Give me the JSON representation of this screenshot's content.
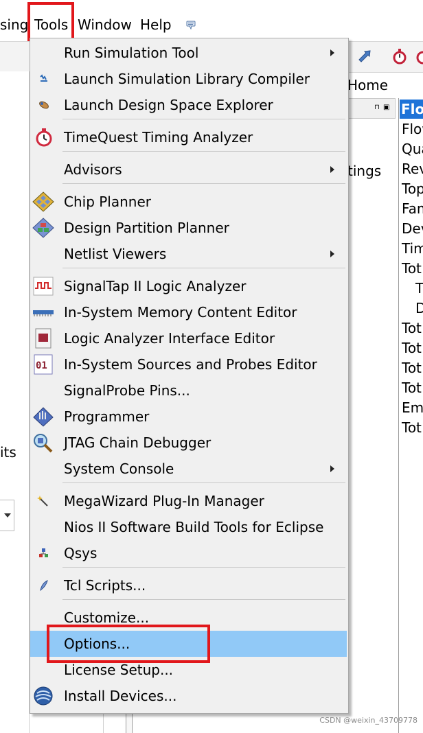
{
  "menubar": {
    "items": [
      "sing",
      "Tools",
      "Window",
      "Help"
    ]
  },
  "background": {
    "home_label": "Home",
    "partial_text_1": "tings",
    "partial_text_2": "its",
    "right_panel": {
      "title": "Flov",
      "rows": [
        "Flow",
        "Qua",
        "Rev",
        "Top",
        "Fam",
        "Dev",
        "Tim",
        "Tot",
        "T",
        "D",
        "Tot",
        "Tot",
        "Tot",
        "Tot",
        "Em",
        "Tot"
      ]
    }
  },
  "tools_menu": {
    "items": [
      {
        "label": "Run Simulation Tool",
        "icon": "none",
        "submenu": true
      },
      {
        "label": "Launch Simulation Library Compiler",
        "icon": "sim-library-icon",
        "submenu": false
      },
      {
        "label": "Launch Design Space Explorer",
        "icon": "design-space-explorer-icon",
        "submenu": false
      },
      {
        "label": "TimeQuest Timing Analyzer",
        "icon": "stopwatch-icon",
        "submenu": false
      },
      {
        "label": "Advisors",
        "icon": "none",
        "submenu": true
      },
      {
        "label": "Chip Planner",
        "icon": "chip-planner-icon",
        "submenu": false
      },
      {
        "label": "Design Partition Planner",
        "icon": "design-partition-icon",
        "submenu": false
      },
      {
        "label": "Netlist Viewers",
        "icon": "none",
        "submenu": true
      },
      {
        "label": "SignalTap II Logic Analyzer",
        "icon": "signaltap-icon",
        "submenu": false
      },
      {
        "label": "In-System Memory Content Editor",
        "icon": "memory-editor-icon",
        "submenu": false
      },
      {
        "label": "Logic Analyzer Interface Editor",
        "icon": "logic-analyzer-icon",
        "submenu": false
      },
      {
        "label": "In-System Sources and Probes Editor",
        "icon": "sources-probes-icon",
        "submenu": false
      },
      {
        "label": "SignalProbe Pins...",
        "icon": "none",
        "submenu": false
      },
      {
        "label": "Programmer",
        "icon": "programmer-icon",
        "submenu": false
      },
      {
        "label": "JTAG Chain Debugger",
        "icon": "jtag-debugger-icon",
        "submenu": false
      },
      {
        "label": "System Console",
        "icon": "none",
        "submenu": true
      },
      {
        "label": "MegaWizard Plug-In Manager",
        "icon": "magic-wand-icon",
        "submenu": false
      },
      {
        "label": "Nios II Software Build Tools for Eclipse",
        "icon": "none",
        "submenu": false
      },
      {
        "label": "Qsys",
        "icon": "qsys-icon",
        "submenu": false
      },
      {
        "label": "Tcl Scripts...",
        "icon": "tcl-script-icon",
        "submenu": false
      },
      {
        "label": "Customize...",
        "icon": "none",
        "submenu": false
      },
      {
        "label": "Options...",
        "icon": "none",
        "submenu": false,
        "highlighted": true
      },
      {
        "label": "License Setup...",
        "icon": "none",
        "submenu": false
      },
      {
        "label": "Install Devices...",
        "icon": "install-devices-icon",
        "submenu": false
      }
    ]
  },
  "annotation": {
    "highlight_color": "#e1171b",
    "hover_color": "#91c9f7"
  },
  "watermark": "CSDN @weixin_43709778"
}
